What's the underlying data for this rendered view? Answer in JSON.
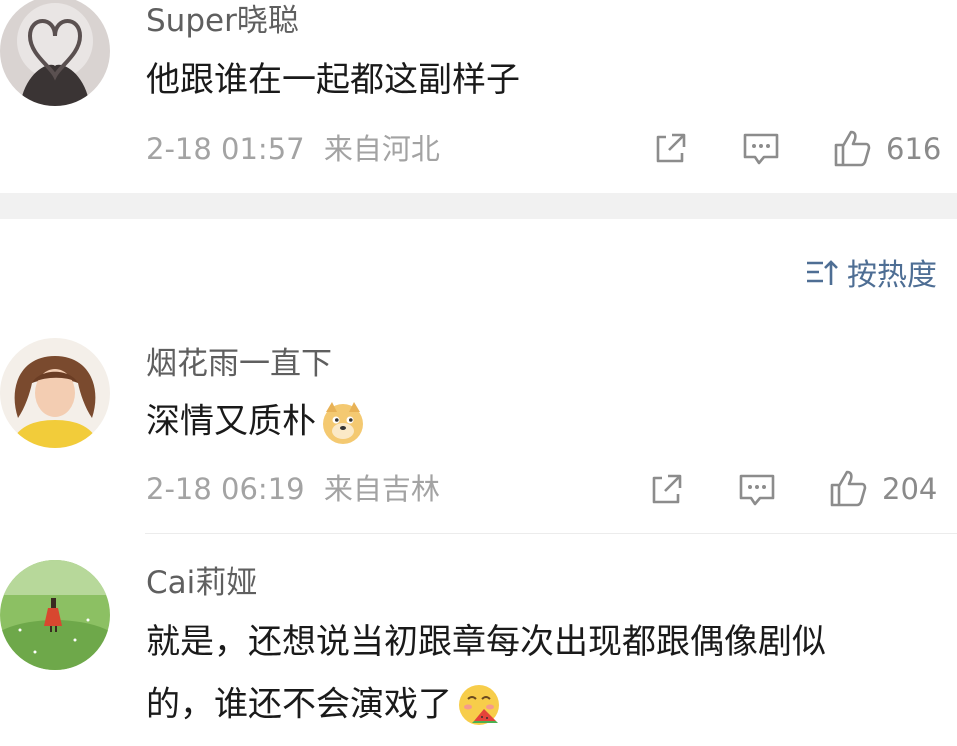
{
  "comments_top": {
    "username": "Super晓聪",
    "text": "他跟谁在一起都这副样子",
    "time": "2-18 01:57",
    "location": "来自河北",
    "likes": "616"
  },
  "sort": {
    "label": "按热度",
    "icon": "sort-icon"
  },
  "comments": [
    {
      "username": "烟花雨一直下",
      "text": "深情又质朴",
      "emoji": "doge-emoji",
      "time": "2-18 06:19",
      "location": "来自吉林",
      "likes": "204"
    },
    {
      "username": "Cai莉娅",
      "text_line1": "就是，还想说当初跟章每次出现都跟偶像剧似",
      "text_line2": "的，谁还不会演戏了",
      "emoji": "eating-watermelon-emoji"
    }
  ],
  "icons": [
    "share-icon",
    "comment-icon",
    "like-icon"
  ],
  "colors": {
    "meta": "#a3a3a3",
    "sort_accent": "#4e6e94",
    "divider": "#f1f1f1"
  }
}
